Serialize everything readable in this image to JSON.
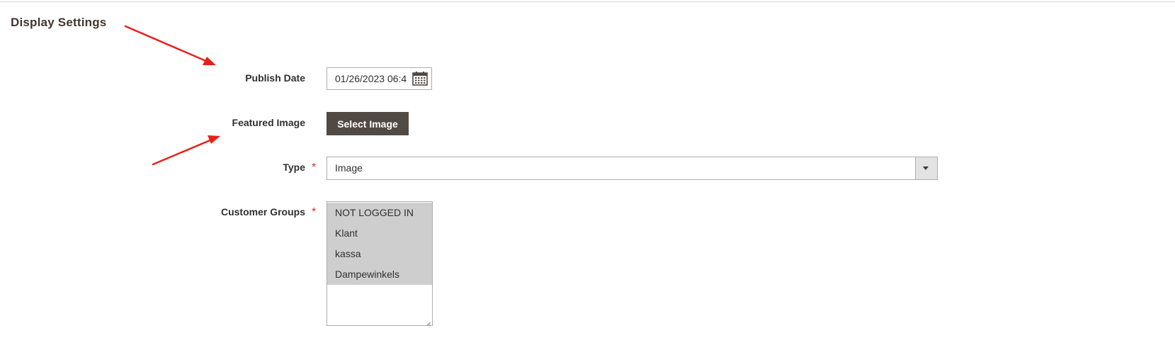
{
  "section": {
    "title": "Display Settings"
  },
  "fields": {
    "publish_date": {
      "label": "Publish Date",
      "value": "01/26/2023 06:4",
      "calendar_icon": "calendar-icon"
    },
    "featured_image": {
      "label": "Featured Image",
      "button_label": "Select Image"
    },
    "type": {
      "label": "Type",
      "required_mark": "*",
      "selected_value": "Image",
      "dropdown_icon": "chevron-down-icon"
    },
    "customer_groups": {
      "label": "Customer Groups",
      "required_mark": "*",
      "options": [
        "NOT LOGGED IN",
        "Klant",
        "kassa",
        "Dampewinkels"
      ]
    }
  },
  "colors": {
    "button_background": "#514943",
    "required_star": "#e02b27",
    "annotation_arrow": "#e8201a",
    "selected_option_bg": "#cecece"
  }
}
